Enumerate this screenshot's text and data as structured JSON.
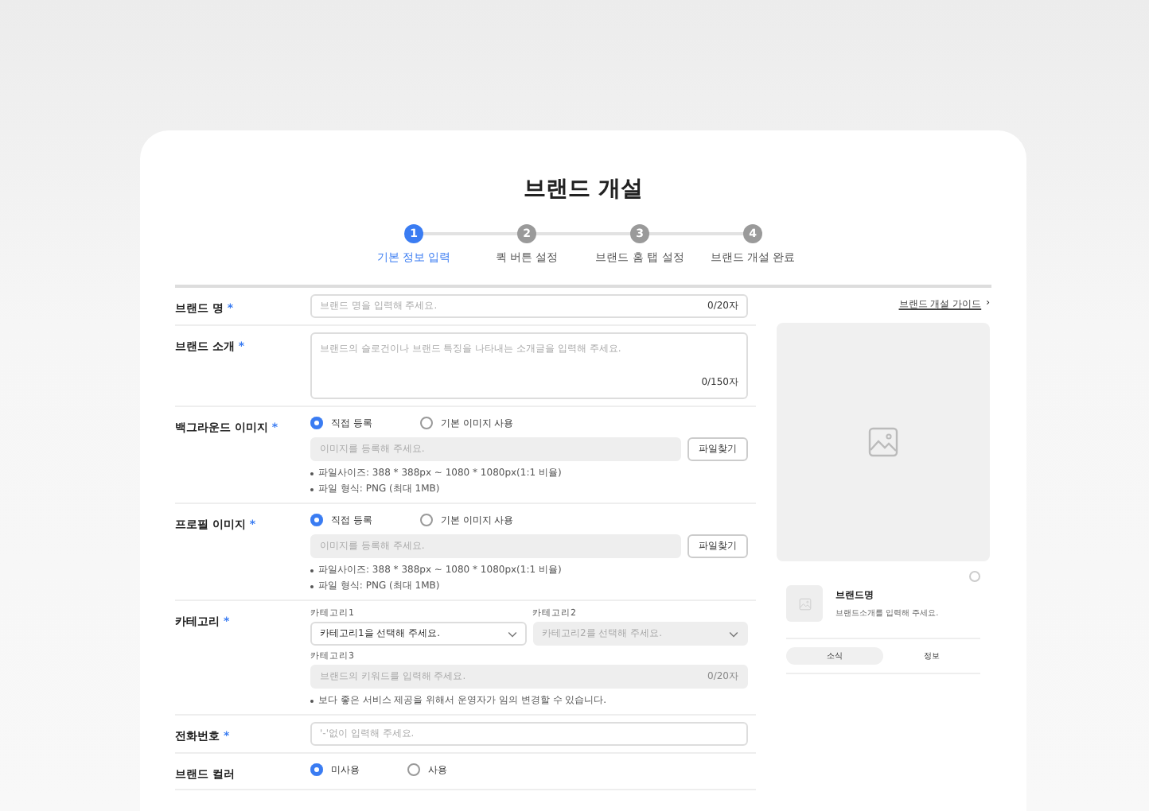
{
  "title": "브랜드 개설",
  "steps": [
    {
      "number": "1",
      "label": "기본 정보 입력",
      "selected": true
    },
    {
      "number": "2",
      "label": "퀵 버튼 설정",
      "selected": false
    },
    {
      "number": "3",
      "label": "브랜드 홈 탭 설정",
      "selected": false
    },
    {
      "number": "4",
      "label": "브랜드 개설 완료",
      "selected": false
    }
  ],
  "form": [
    {
      "kind": "text",
      "label": "브랜드 명",
      "mark": "*",
      "placeholder": "브랜드 명을 입력해 주세요.",
      "counter": "0/20자"
    },
    {
      "kind": "textarea",
      "label": "브랜드 소개",
      "mark": "*",
      "placeholder": "브랜드의 슬로건이나 브랜드 특징을 나타내는 소개글을 입력해 주세요.",
      "counter": "0/150자"
    },
    {
      "kind": "image",
      "label": "백그라운드 이미지",
      "mark": "*",
      "radios": [
        {
          "label": "직접 등록",
          "selected": true
        },
        {
          "label": "기본 이미지 사용",
          "selected": false
        }
      ],
      "placeholder": "이미지를 등록해 주세요.",
      "button": "파일찾기",
      "notes": [
        "파일사이즈: 388 * 388px ~ 1080 * 1080px(1:1 비율)",
        "파일 형식: PNG (최대 1MB)"
      ]
    },
    {
      "kind": "image",
      "label": "프로필 이미지",
      "mark": "*",
      "radios": [
        {
          "label": "직접 등록",
          "selected": true
        },
        {
          "label": "기본 이미지 사용",
          "selected": false
        }
      ],
      "placeholder": "이미지를 등록해 주세요.",
      "button": "파일찾기",
      "notes": [
        "파일사이즈: 388 * 388px ~ 1080 * 1080px(1:1 비율)",
        "파일 형식: PNG (최대 1MB)"
      ]
    },
    {
      "kind": "category",
      "label": "카테고리",
      "mark": "*",
      "fields": [
        {
          "kind": "select",
          "label": "카테고리1",
          "placeholder": "카테고리1을 선택해 주세요.",
          "disabled": false
        },
        {
          "kind": "select",
          "label": "카테고리2",
          "placeholder": "카테고리2를 선택해 주세요.",
          "disabled": true
        },
        {
          "kind": "input",
          "label": "카테고리3",
          "placeholder": "브랜드의 키워드를 입력해 주세요.",
          "counter": "0/20자",
          "disabled": true
        }
      ],
      "notes": [
        "보다 좋은 서비스 제공을 위해서 운영자가 임의 변경할 수 있습니다."
      ]
    },
    {
      "kind": "text",
      "label": "전화번호",
      "mark": "*",
      "placeholder": "'-'없이 입력해 주세요."
    },
    {
      "kind": "radio",
      "label": "브랜드 컬러",
      "radios": [
        {
          "label": "미사용",
          "selected": true
        },
        {
          "label": "사용",
          "selected": false
        }
      ]
    }
  ],
  "sidebar": {
    "guide_link": "브랜드 개설 가이드",
    "guide_chevron": "›",
    "preview": {
      "name": "브랜드명",
      "intro": "브랜드소개를 입력해 주세요.",
      "tabs": [
        {
          "label": "소식",
          "selected": true
        },
        {
          "label": "정보",
          "selected": false
        }
      ]
    }
  }
}
